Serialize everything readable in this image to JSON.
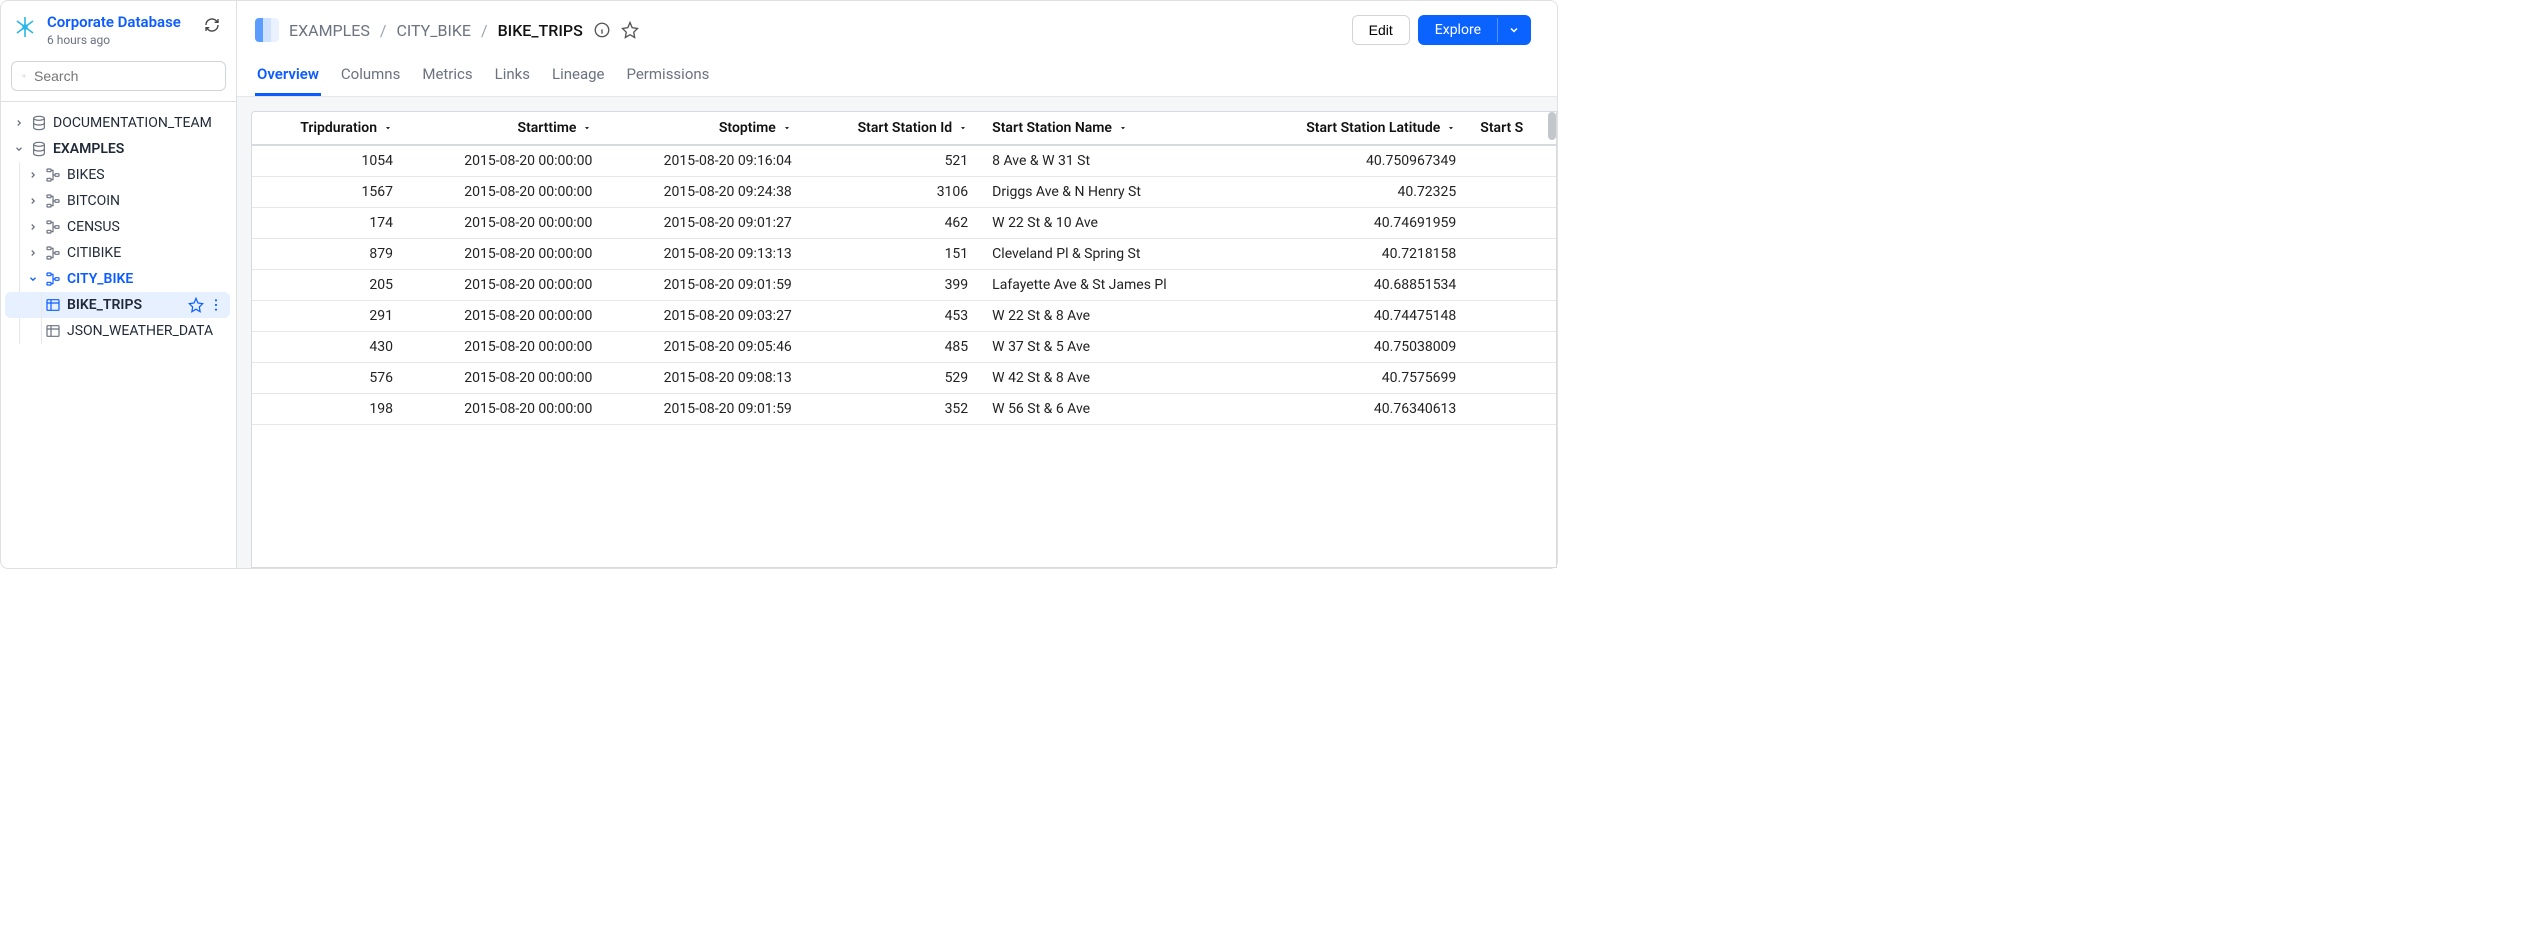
{
  "sidebar": {
    "title": "Corporate Database",
    "subtitle": "6 hours ago",
    "search_placeholder": "Search"
  },
  "tree": {
    "doc_team": "DOCUMENTATION_TEAM",
    "examples": "EXAMPLES",
    "bikes": "BIKES",
    "bitcoin": "BITCOIN",
    "census": "CENSUS",
    "citibike": "CITIBIKE",
    "city_bike": "CITY_BIKE",
    "bike_trips": "BIKE_TRIPS",
    "json_weather": "JSON_WEATHER_DATA"
  },
  "breadcrumb": {
    "root": "EXAMPLES",
    "mid": "CITY_BIKE",
    "current": "BIKE_TRIPS"
  },
  "actions": {
    "edit": "Edit",
    "explore": "Explore"
  },
  "tabs": {
    "overview": "Overview",
    "columns": "Columns",
    "metrics": "Metrics",
    "links": "Links",
    "lineage": "Lineage",
    "permissions": "Permissions"
  },
  "table": {
    "headers": {
      "tripduration": "Tripduration",
      "starttime": "Starttime",
      "stoptime": "Stoptime",
      "start_station_id": "Start Station Id",
      "start_station_name": "Start Station Name",
      "start_station_latitude": "Start Station Latitude",
      "start_station_partial": "Start S"
    },
    "rows": [
      {
        "d": "1054",
        "st": "2015-08-20 00:00:00",
        "sp": "2015-08-20 09:16:04",
        "sid": "521",
        "sn": "8 Ave & W 31 St",
        "lat": "40.750967349"
      },
      {
        "d": "1567",
        "st": "2015-08-20 00:00:00",
        "sp": "2015-08-20 09:24:38",
        "sid": "3106",
        "sn": "Driggs Ave & N Henry St",
        "lat": "40.72325"
      },
      {
        "d": "174",
        "st": "2015-08-20 00:00:00",
        "sp": "2015-08-20 09:01:27",
        "sid": "462",
        "sn": "W 22 St & 10 Ave",
        "lat": "40.74691959"
      },
      {
        "d": "879",
        "st": "2015-08-20 00:00:00",
        "sp": "2015-08-20 09:13:13",
        "sid": "151",
        "sn": "Cleveland Pl & Spring St",
        "lat": "40.7218158"
      },
      {
        "d": "205",
        "st": "2015-08-20 00:00:00",
        "sp": "2015-08-20 09:01:59",
        "sid": "399",
        "sn": "Lafayette Ave & St James Pl",
        "lat": "40.68851534"
      },
      {
        "d": "291",
        "st": "2015-08-20 00:00:00",
        "sp": "2015-08-20 09:03:27",
        "sid": "453",
        "sn": "W 22 St & 8 Ave",
        "lat": "40.74475148"
      },
      {
        "d": "430",
        "st": "2015-08-20 00:00:00",
        "sp": "2015-08-20 09:05:46",
        "sid": "485",
        "sn": "W 37 St & 5 Ave",
        "lat": "40.75038009"
      },
      {
        "d": "576",
        "st": "2015-08-20 00:00:00",
        "sp": "2015-08-20 09:08:13",
        "sid": "529",
        "sn": "W 42 St & 8 Ave",
        "lat": "40.7575699"
      },
      {
        "d": "198",
        "st": "2015-08-20 00:00:00",
        "sp": "2015-08-20 09:01:59",
        "sid": "352",
        "sn": "W 56 St & 6 Ave",
        "lat": "40.76340613"
      }
    ]
  }
}
